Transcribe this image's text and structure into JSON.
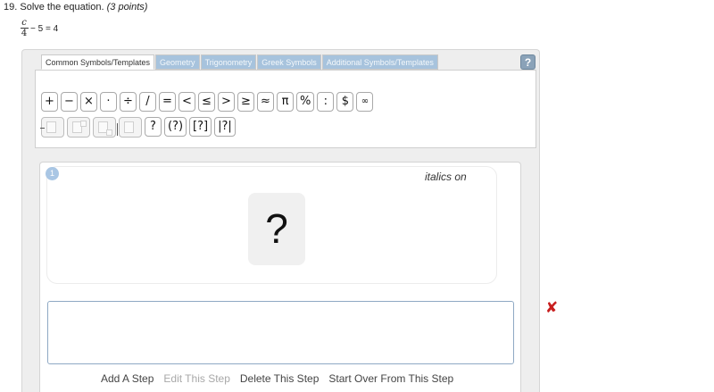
{
  "question": {
    "number": "19.",
    "prompt": "Solve the equation.",
    "points": "(3 points)"
  },
  "equation": {
    "numerator": "c",
    "denominator": "4",
    "rest": "− 5 = 4"
  },
  "tabs": [
    {
      "label": "Common Symbols/Templates",
      "active": true
    },
    {
      "label": "Geometry",
      "active": false
    },
    {
      "label": "Trigonometry",
      "active": false
    },
    {
      "label": "Greek Symbols",
      "active": false
    },
    {
      "label": "Additional Symbols/Templates",
      "active": false
    }
  ],
  "help_label": "?",
  "symbols_row1": [
    "+",
    "−",
    "×",
    "·",
    "÷",
    "/",
    "=",
    "<",
    "≤",
    ">",
    "≥",
    "≈",
    "π",
    "%",
    ":",
    "$",
    "∞"
  ],
  "templates_row2": [
    "fraction-template-icon",
    "superscript-template-icon",
    "subscript-template-icon",
    "square-root-template-icon"
  ],
  "symbols_row2": [
    "?",
    "(?)",
    "[?]",
    "|?|"
  ],
  "step": {
    "number": "1",
    "italics_label": "italics on",
    "placeholder": "?"
  },
  "answer_value": "",
  "step_actions": [
    {
      "label": "Add A Step",
      "enabled": true
    },
    {
      "label": "Edit This Step",
      "enabled": false
    },
    {
      "label": "Delete This Step",
      "enabled": true
    },
    {
      "label": "Start Over From This Step",
      "enabled": true
    }
  ],
  "close_symbol": "✘",
  "colors": {
    "inactive_tab": "#a7c3dd",
    "help_button": "#8aa2b8",
    "step_badge": "#a9c6e4",
    "delete_mark": "#c81e1e"
  }
}
